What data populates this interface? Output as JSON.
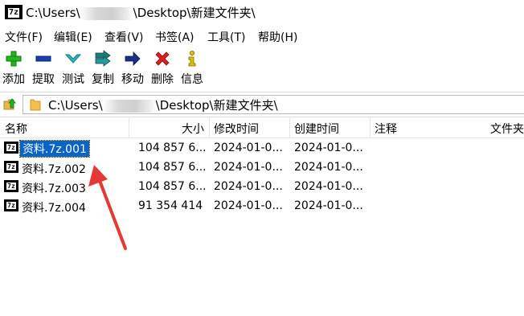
{
  "window": {
    "title_prefix": "C:\\Users\\",
    "title_suffix": "\\Desktop\\新建文件夹\\",
    "app_icon_text": "7z"
  },
  "menu": [
    {
      "label": "文件(F)"
    },
    {
      "label": "编辑(E)"
    },
    {
      "label": "查看(V)"
    },
    {
      "label": "书签(A)"
    },
    {
      "label": "工具(T)"
    },
    {
      "label": "帮助(H)"
    }
  ],
  "toolbar": [
    {
      "label": "添加",
      "icon": "plus-icon",
      "color": "#1fb51f"
    },
    {
      "label": "提取",
      "icon": "minus-icon",
      "color": "#1a3fb0"
    },
    {
      "label": "测试",
      "icon": "check-chevron-icon",
      "color": "#2bb6c4"
    },
    {
      "label": "复制",
      "icon": "double-arrow-icon",
      "color": "#1f7a7a"
    },
    {
      "label": "移动",
      "icon": "arrow-right-icon",
      "color": "#1a2e8a"
    },
    {
      "label": "删除",
      "icon": "x-icon",
      "color": "#d81e1e"
    },
    {
      "label": "信息",
      "icon": "info-icon",
      "color": "#e0c000"
    }
  ],
  "address": {
    "prefix": "C:\\Users\\",
    "suffix": "\\Desktop\\新建文件夹\\"
  },
  "columns": [
    "名称",
    "大小",
    "修改时间",
    "创建时间",
    "注释",
    "文件夹"
  ],
  "files": [
    {
      "name": "资料.7z.001",
      "size": "104 857 6...",
      "modified": "2024-01-0...",
      "created": "2024-01-0...",
      "selected": true
    },
    {
      "name": "资料.7z.002",
      "size": "104 857 6...",
      "modified": "2024-01-0...",
      "created": "2024-01-0...",
      "selected": false
    },
    {
      "name": "资料.7z.003",
      "size": "104 857 6...",
      "modified": "2024-01-0...",
      "created": "2024-01-0...",
      "selected": false
    },
    {
      "name": "资料.7z.004",
      "size": "91 354 414",
      "modified": "2024-01-0...",
      "created": "2024-01-0...",
      "selected": false
    }
  ],
  "colors": {
    "selection": "#0a64c8",
    "annotation_arrow": "#e53935"
  }
}
